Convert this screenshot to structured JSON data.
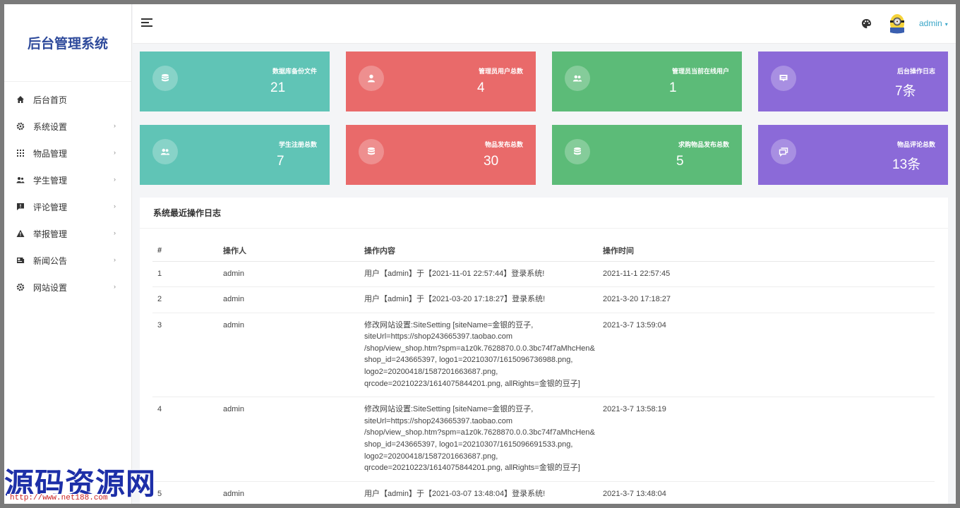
{
  "brand": "后台管理系统",
  "sidebar": {
    "items": [
      {
        "label": "后台首页",
        "icon": "home-icon",
        "has_submenu": false
      },
      {
        "label": "系统设置",
        "icon": "gear-icon",
        "has_submenu": true
      },
      {
        "label": "物品管理",
        "icon": "grid-icon",
        "has_submenu": true
      },
      {
        "label": "学生管理",
        "icon": "users-icon",
        "has_submenu": true
      },
      {
        "label": "评论管理",
        "icon": "comment-alert-icon",
        "has_submenu": true
      },
      {
        "label": "举报管理",
        "icon": "warning-icon",
        "has_submenu": true
      },
      {
        "label": "新闻公告",
        "icon": "news-icon",
        "has_submenu": true
      },
      {
        "label": "网站设置",
        "icon": "gear-icon",
        "has_submenu": true
      }
    ]
  },
  "topbar": {
    "user": "admin",
    "chevron": "▾"
  },
  "stats": [
    {
      "label": "数据库备份文件",
      "value": "21",
      "color": "#60c4b6",
      "icon": "database-icon"
    },
    {
      "label": "管理员用户总数",
      "value": "4",
      "color": "#e96a6a",
      "icon": "user-icon"
    },
    {
      "label": "管理员当前在线用户",
      "value": "1",
      "color": "#5cbb78",
      "icon": "users-icon"
    },
    {
      "label": "后台操作日志",
      "value": "7条",
      "color": "#8b6ad8",
      "icon": "message-icon"
    },
    {
      "label": "学生注册总数",
      "value": "7",
      "color": "#60c4b6",
      "icon": "users-icon"
    },
    {
      "label": "物品发布总数",
      "value": "30",
      "color": "#e96a6a",
      "icon": "database-icon"
    },
    {
      "label": "求购物品发布总数",
      "value": "5",
      "color": "#5cbb78",
      "icon": "database-icon"
    },
    {
      "label": "物品评论总数",
      "value": "13条",
      "color": "#8b6ad8",
      "icon": "comments-icon"
    }
  ],
  "log": {
    "title": "系统最近操作日志",
    "columns": [
      "#",
      "操作人",
      "操作内容",
      "操作时间"
    ],
    "rows": [
      {
        "id": "1",
        "user": "admin",
        "content": "用户【admin】于【2021-11-01 22:57:44】登录系统!",
        "time": "2021-11-1 22:57:45"
      },
      {
        "id": "2",
        "user": "admin",
        "content": "用户【admin】于【2021-03-20 17:18:27】登录系统!",
        "time": "2021-3-20 17:18:27"
      },
      {
        "id": "3",
        "user": "admin",
        "content": "修改网站设置:SiteSetting [siteName=金银的豆子,\nsiteUrl=https://shop243665397.taobao.com\n/shop/view_shop.htm?spm=a1z0k.7628870.0.0.3bc74f7aMhcHen&\nshop_id=243665397, logo1=20210307/1615096736988.png,\nlogo2=20200418/1587201663687.png,\nqrcode=20210223/1614075844201.png, allRights=金银的豆子]",
        "time": "2021-3-7 13:59:04"
      },
      {
        "id": "4",
        "user": "admin",
        "content": "修改网站设置:SiteSetting [siteName=金银的豆子,\nsiteUrl=https://shop243665397.taobao.com\n/shop/view_shop.htm?spm=a1z0k.7628870.0.0.3bc74f7aMhcHen&\nshop_id=243665397, logo1=20210307/1615096691533.png,\nlogo2=20200418/1587201663687.png,\nqrcode=20210223/1614075844201.png, allRights=金银的豆子]",
        "time": "2021-3-7 13:58:19"
      },
      {
        "id": "5",
        "user": "admin",
        "content": "用户【admin】于【2021-03-07 13:48:04】登录系统!",
        "time": "2021-3-7 13:48:04"
      }
    ]
  },
  "watermark": {
    "text": "源码资源网",
    "url": "http://www.net188.com"
  }
}
